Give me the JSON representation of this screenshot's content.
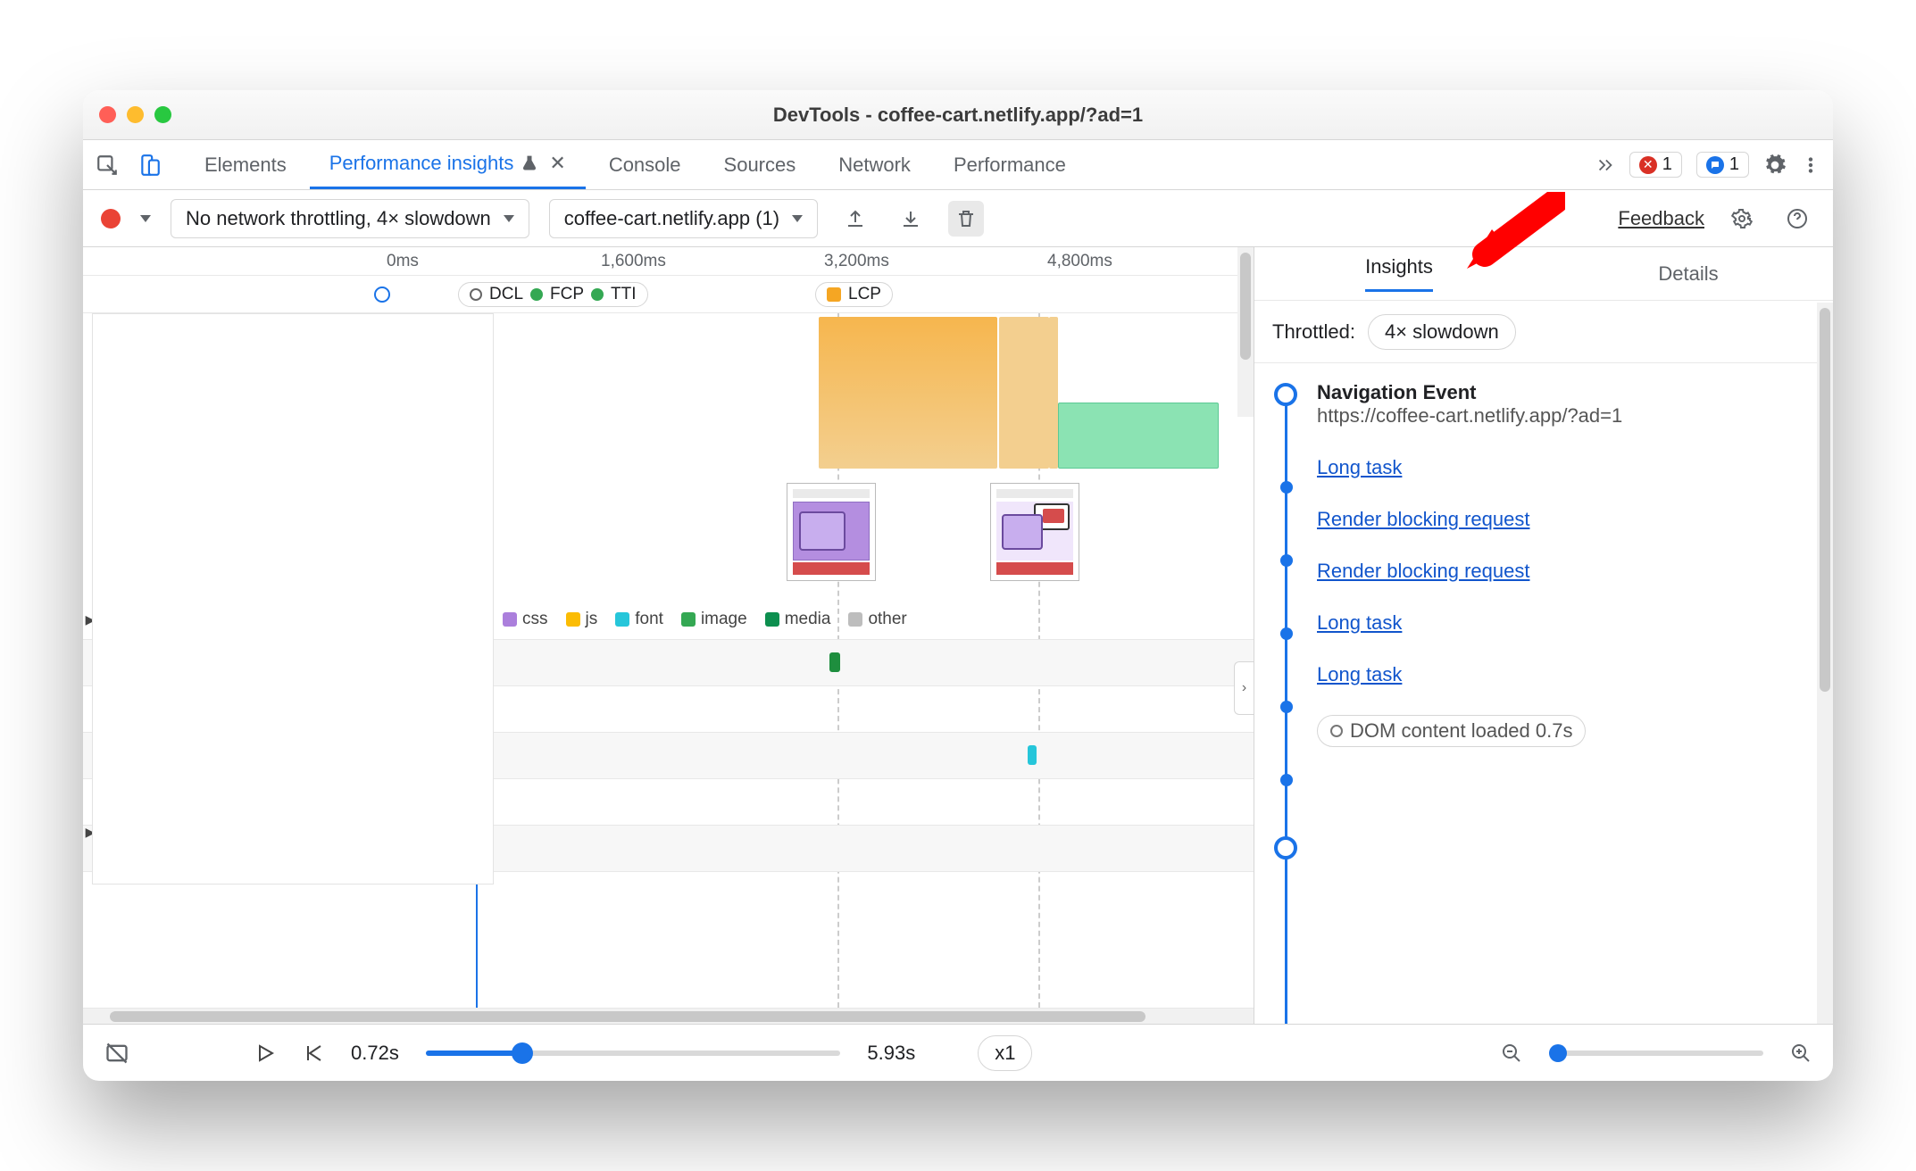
{
  "window": {
    "title": "DevTools - coffee-cart.netlify.app/?ad=1"
  },
  "tabs": {
    "elements": "Elements",
    "perf_insights": "Performance insights",
    "console": "Console",
    "sources": "Sources",
    "network": "Network",
    "performance": "Performance",
    "errors_count": "1",
    "messages_count": "1"
  },
  "toolbar": {
    "throttling_select": "No network throttling, 4× slowdown",
    "recording_select": "coffee-cart.netlify.app (1)",
    "feedback": "Feedback"
  },
  "timeline": {
    "ticks": {
      "t0": "0ms",
      "t1": "1,600ms",
      "t2": "3,200ms",
      "t3": "4,800ms"
    },
    "markers": {
      "dcl": "DCL",
      "fcp": "FCP",
      "tti": "TTI",
      "lcp": "LCP"
    },
    "legend": {
      "css": "css",
      "js": "js",
      "font": "font",
      "image": "image",
      "media": "media",
      "other": "other"
    }
  },
  "right": {
    "tabs": {
      "insights": "Insights",
      "details": "Details"
    },
    "throttled_label": "Throttled:",
    "throttled_value": "4× slowdown",
    "events": {
      "nav_title": "Navigation Event",
      "nav_sub": "https://coffee-cart.netlify.app/?ad=1",
      "long_task": "Long task",
      "render_block": "Render blocking request",
      "dcl_pill": "DOM content loaded 0.7s"
    }
  },
  "bottom": {
    "current_time": "0.72s",
    "total_time": "5.93s",
    "speed": "x1"
  }
}
